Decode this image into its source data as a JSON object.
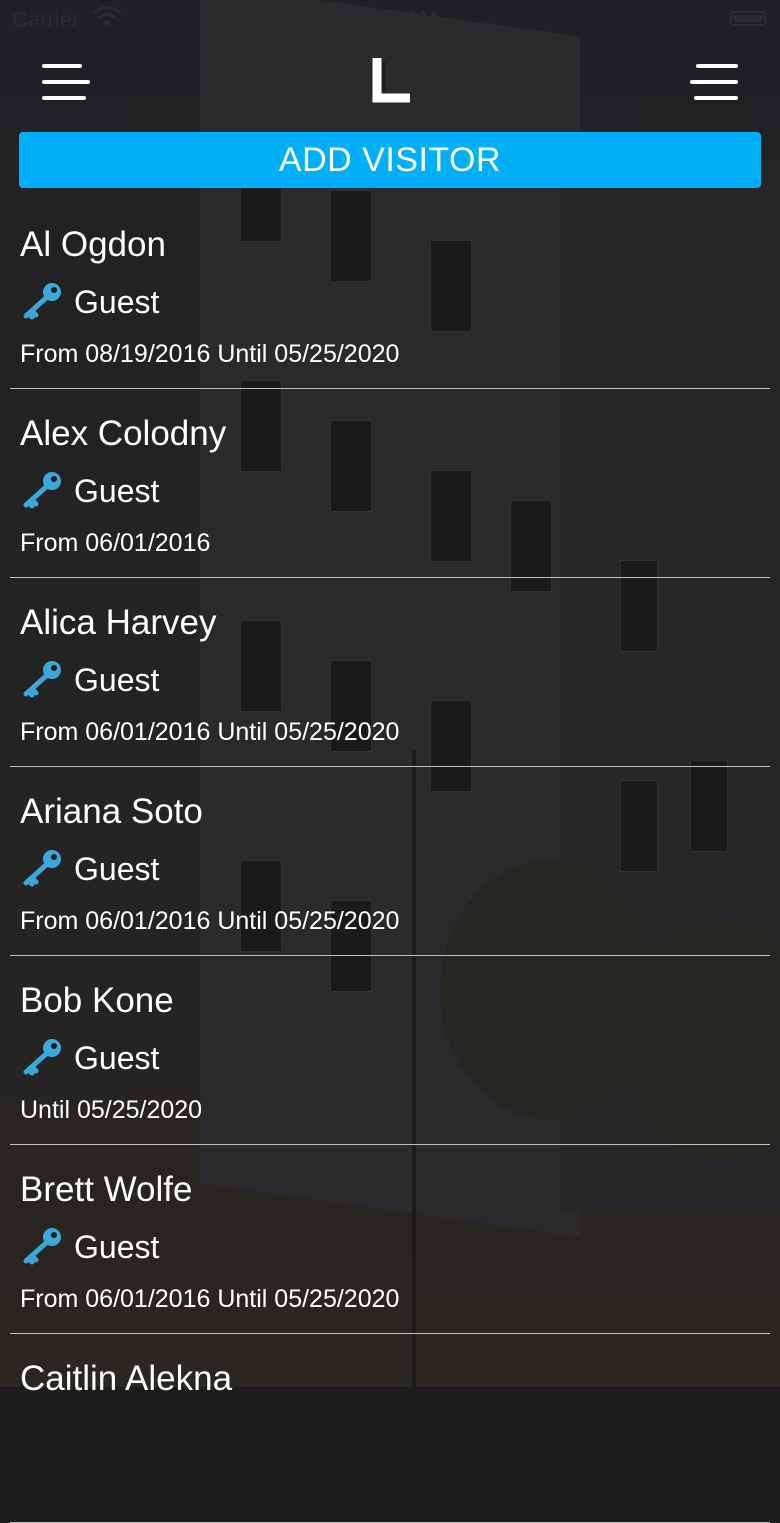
{
  "status_bar": {
    "carrier": "Carrier",
    "time": "10:18 AM"
  },
  "header": {
    "left_menu_icon": "hamburger-menu-icon",
    "logo_icon": "building-l-logo",
    "right_menu_icon": "list-menu-icon"
  },
  "add_visitor_label": "ADD VISITOR",
  "colors": {
    "accent": "#00b0f6",
    "key_icon": "#3aa8d8"
  },
  "visitors": [
    {
      "name": "Al Ogdon",
      "role": "Guest",
      "dates": "From 08/19/2016 Until 05/25/2020"
    },
    {
      "name": "Alex Colodny",
      "role": "Guest",
      "dates": "From 06/01/2016"
    },
    {
      "name": "Alica Harvey",
      "role": "Guest",
      "dates": "From 06/01/2016 Until 05/25/2020"
    },
    {
      "name": "Ariana Soto",
      "role": "Guest",
      "dates": "From 06/01/2016 Until 05/25/2020"
    },
    {
      "name": "Bob Kone",
      "role": "Guest",
      "dates": "Until 05/25/2020"
    },
    {
      "name": "Brett Wolfe",
      "role": "Guest",
      "dates": "From 06/01/2016 Until 05/25/2020"
    },
    {
      "name": "Caitlin Alekna",
      "role": "",
      "dates": ""
    }
  ]
}
